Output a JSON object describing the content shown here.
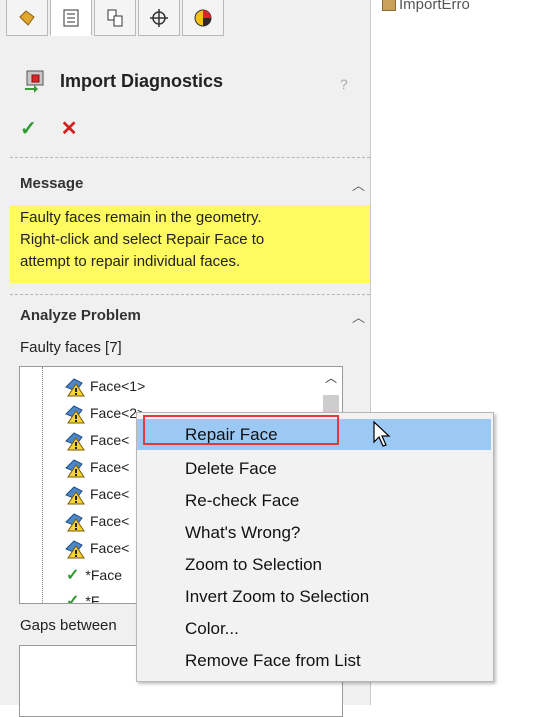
{
  "canvas": {
    "label": "ImportErro"
  },
  "tabs": [
    {
      "icon": "feature-manager-icon",
      "active": false
    },
    {
      "icon": "property-manager-icon",
      "active": true
    },
    {
      "icon": "configuration-manager-icon",
      "active": false
    },
    {
      "icon": "dimxpert-manager-icon",
      "active": false
    },
    {
      "icon": "display-manager-icon",
      "active": false
    }
  ],
  "panel": {
    "title": "Import Diagnostics",
    "ok_label": "✓",
    "cancel_label": "✕"
  },
  "message": {
    "header": "Message",
    "lines": [
      "Faulty faces remain in the geometry.",
      "Right-click and select Repair Face to",
      "attempt to repair individual faces."
    ]
  },
  "analyze": {
    "header": "Analyze Problem",
    "faulty_label": "Faulty faces [7]",
    "faces": [
      {
        "label": "Face<1>",
        "status": "warning"
      },
      {
        "label": "Face<2>",
        "status": "warning"
      },
      {
        "label": "Face<",
        "status": "warning"
      },
      {
        "label": "Face<",
        "status": "warning"
      },
      {
        "label": "Face<",
        "status": "warning"
      },
      {
        "label": "Face<",
        "status": "warning"
      },
      {
        "label": "Face<",
        "status": "warning"
      },
      {
        "label": "*Face",
        "status": "ok"
      },
      {
        "label": "*F",
        "status": "ok"
      }
    ],
    "gaps_label": "Gaps between"
  },
  "context_menu": {
    "items": [
      "Repair Face",
      "Delete Face",
      "Re-check Face",
      "What's Wrong?",
      "Zoom to Selection",
      "Invert Zoom to Selection",
      "Color...",
      "Remove Face from List"
    ]
  }
}
